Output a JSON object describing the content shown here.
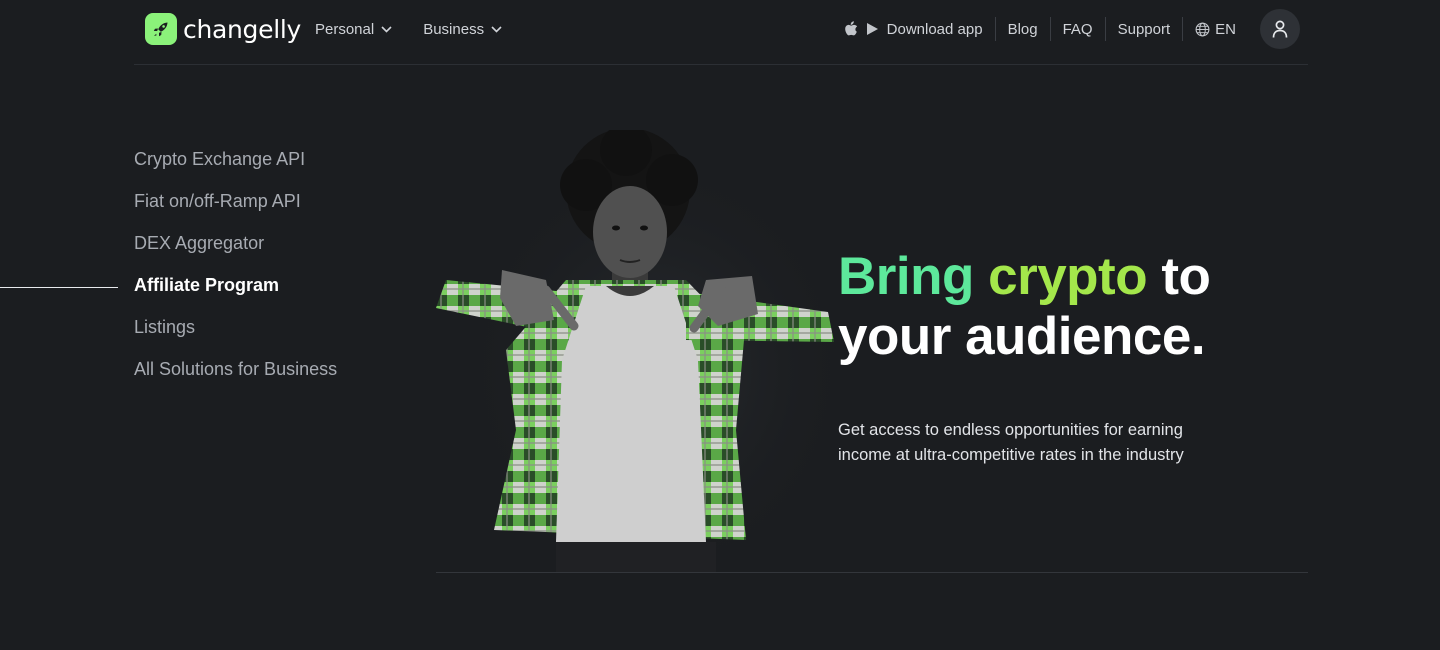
{
  "brand": {
    "name": "changelly",
    "accent": "#8bf27a"
  },
  "nav": {
    "personal": "Personal",
    "business": "Business",
    "download": "Download app",
    "blog": "Blog",
    "faq": "FAQ",
    "support": "Support",
    "language": "EN"
  },
  "icons": {
    "logo": "rocket-icon",
    "apple": "apple-icon",
    "play": "play-store-icon",
    "globe": "globe-icon",
    "user": "user-icon",
    "chevron": "chevron-down-icon"
  },
  "side_menu": {
    "items": [
      {
        "label": "Crypto Exchange API"
      },
      {
        "label": "Fiat on/off-Ramp API"
      },
      {
        "label": "DEX Aggregator"
      },
      {
        "label": "Affiliate Program",
        "active": true
      },
      {
        "label": "Listings"
      },
      {
        "label": "All Solutions for Business"
      }
    ]
  },
  "hero": {
    "title_part1": "Bring",
    "title_part2": "crypto",
    "title_part3": "to your audience.",
    "subtitle": "Get access to endless opportunities for earning income at ultra-competitive rates in the industry",
    "colors": {
      "word1": "#5de89b",
      "word2": "#a4e74b"
    }
  }
}
